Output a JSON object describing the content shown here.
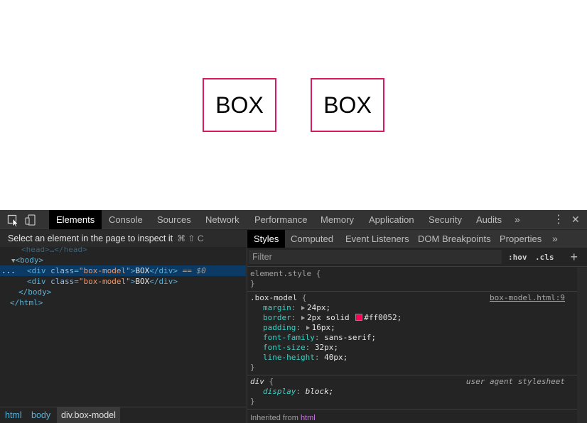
{
  "page": {
    "boxes": [
      "BOX",
      "BOX"
    ]
  },
  "devtools": {
    "tabs": [
      "Elements",
      "Console",
      "Sources",
      "Network",
      "Performance",
      "Memory",
      "Application",
      "Security",
      "Audits"
    ],
    "more_tabs_glyph": "»",
    "menu_glyph": "⋮",
    "close_glyph": "✕",
    "inspect_hint": "Select an element in the page to inspect it",
    "inspect_shortcut": "⌘ ⇧ C",
    "dom_tree": {
      "head_fragment": "<head>…</head>",
      "body_open": "<body>",
      "row1": {
        "open": "<div ",
        "attr": "class",
        "val": "\"box-model\"",
        "close_open": ">",
        "text": "BOX",
        "end": "</div>",
        "selected_marker": "== $0"
      },
      "row2": {
        "open": "<div ",
        "attr": "class",
        "val": "\"box-model\"",
        "close_open": ">",
        "text": "BOX",
        "end": "</div>"
      },
      "body_close": "</body>",
      "html_close": "</html>",
      "ellipsis": "..."
    },
    "breadcrumbs": [
      "html",
      "body",
      "div.box-model"
    ],
    "styles_tabs": [
      "Styles",
      "Computed",
      "Event Listeners",
      "DOM Breakpoints",
      "Properties"
    ],
    "styles_more": "»",
    "filter_placeholder": "Filter",
    "hov_label": ":hov",
    "cls_label": ".cls",
    "add_rule": "+",
    "rules": {
      "element_style": {
        "selector": "element.style {",
        "close": "}"
      },
      "box_model": {
        "selector": ".box-model",
        "open": "{",
        "source": "box-model.html:9",
        "decls": [
          {
            "name": "margin",
            "value": "24px;"
          },
          {
            "name": "border",
            "value": "2px solid",
            "color_value": "#ff0052;"
          },
          {
            "name": "padding",
            "value": "16px;"
          },
          {
            "name": "font-family",
            "value": "sans-serif;"
          },
          {
            "name": "font-size",
            "value": "32px;"
          },
          {
            "name": "line-height",
            "value": "40px;"
          }
        ],
        "close": "}"
      },
      "div_ua": {
        "selector": "div",
        "open": "{",
        "source": "user agent stylesheet",
        "decls": [
          {
            "name": "display",
            "value": "block;"
          }
        ],
        "close": "}"
      }
    },
    "inherited_label": "Inherited from",
    "inherited_from": "html",
    "colors": {
      "box_border": "#d81b60",
      "swatch": "#ff0052",
      "selection": "#0b3a64"
    }
  }
}
